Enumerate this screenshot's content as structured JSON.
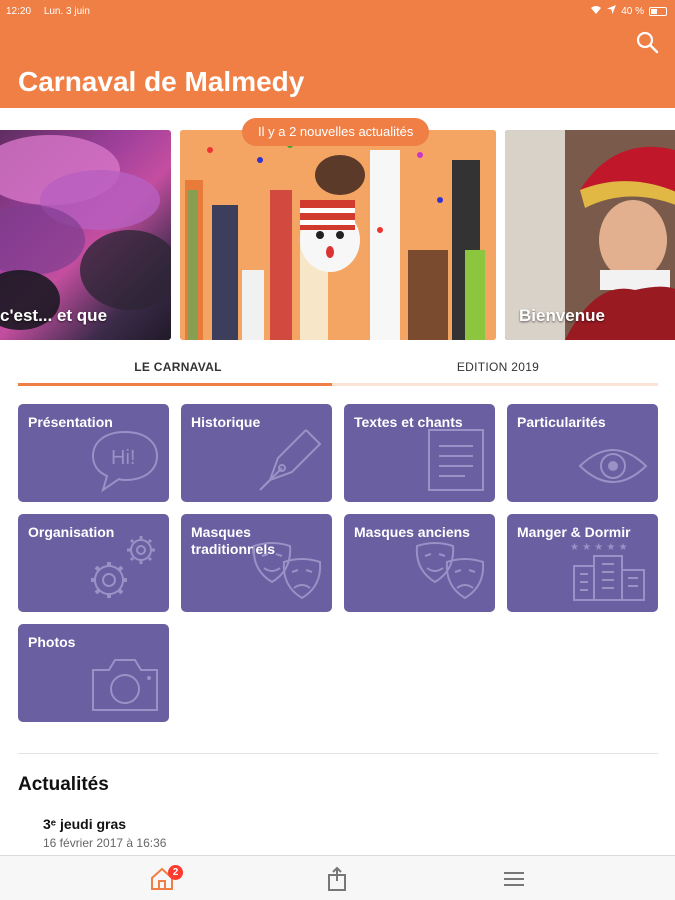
{
  "status_bar": {
    "time": "12:20",
    "date": "Lun. 3 juin",
    "battery": "40 %"
  },
  "header": {
    "title": "Carnaval de Malmedy",
    "search_icon": "search-icon"
  },
  "news_pill": "Il y a 2 nouvelles actualités",
  "carousel": {
    "slides": [
      {
        "caption": "c'est... et que"
      },
      {
        "caption": ""
      },
      {
        "caption": "Bienvenue"
      }
    ]
  },
  "tabs": [
    {
      "label": "LE CARNAVAL",
      "active": true
    },
    {
      "label": "EDITION 2019",
      "active": false
    }
  ],
  "tiles": [
    {
      "label": "Présentation",
      "icon": "speech-bubble-icon"
    },
    {
      "label": "Historique",
      "icon": "fountain-pen-icon"
    },
    {
      "label": "Textes et chants",
      "icon": "document-icon"
    },
    {
      "label": "Particularités",
      "icon": "eye-icon"
    },
    {
      "label": "Organisation",
      "icon": "gears-icon"
    },
    {
      "label": "Masques traditionnels",
      "icon": "theater-masks-icon"
    },
    {
      "label": "Masques anciens",
      "icon": "theater-masks-icon"
    },
    {
      "label": "Manger & Dormir",
      "icon": "hotel-buildings-icon"
    },
    {
      "label": "Photos",
      "icon": "camera-icon"
    }
  ],
  "news": {
    "section_title": "Actualités",
    "items": [
      {
        "title": "3ᵉ jeudi gras",
        "date": "16 février 2017 à 16:36"
      }
    ]
  },
  "bottom_nav": {
    "items": [
      {
        "icon": "home-icon",
        "badge": "2",
        "active": true
      },
      {
        "icon": "share-icon"
      },
      {
        "icon": "menu-icon"
      }
    ]
  },
  "colors": {
    "accent": "#ef7f45",
    "tile": "#6a5fa1",
    "tab_line": "#fbe3d5"
  }
}
